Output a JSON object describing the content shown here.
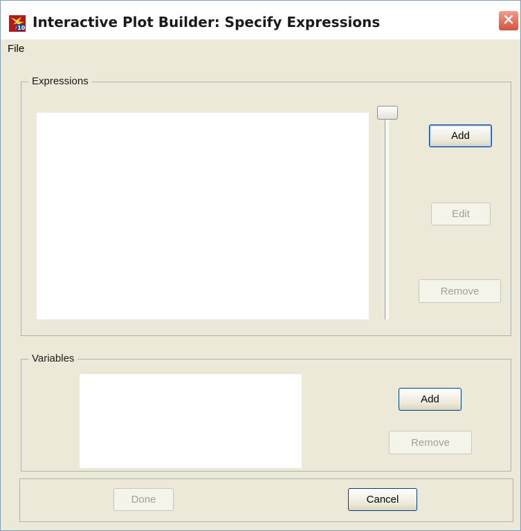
{
  "window": {
    "title": "Interactive Plot Builder: Specify Expressions"
  },
  "menubar": {
    "file_label": "File"
  },
  "expressions": {
    "group_label": "Expressions",
    "add_label": "Add",
    "edit_label": "Edit",
    "remove_label": "Remove"
  },
  "variables": {
    "group_label": "Variables",
    "add_label": "Add",
    "remove_label": "Remove"
  },
  "footer": {
    "done_label": "Done",
    "cancel_label": "Cancel"
  },
  "colors": {
    "window_background": "#ece9d8",
    "button_border": "#003c74",
    "close_button": "#d2553d"
  },
  "icons": [
    "app-icon",
    "close-icon"
  ]
}
